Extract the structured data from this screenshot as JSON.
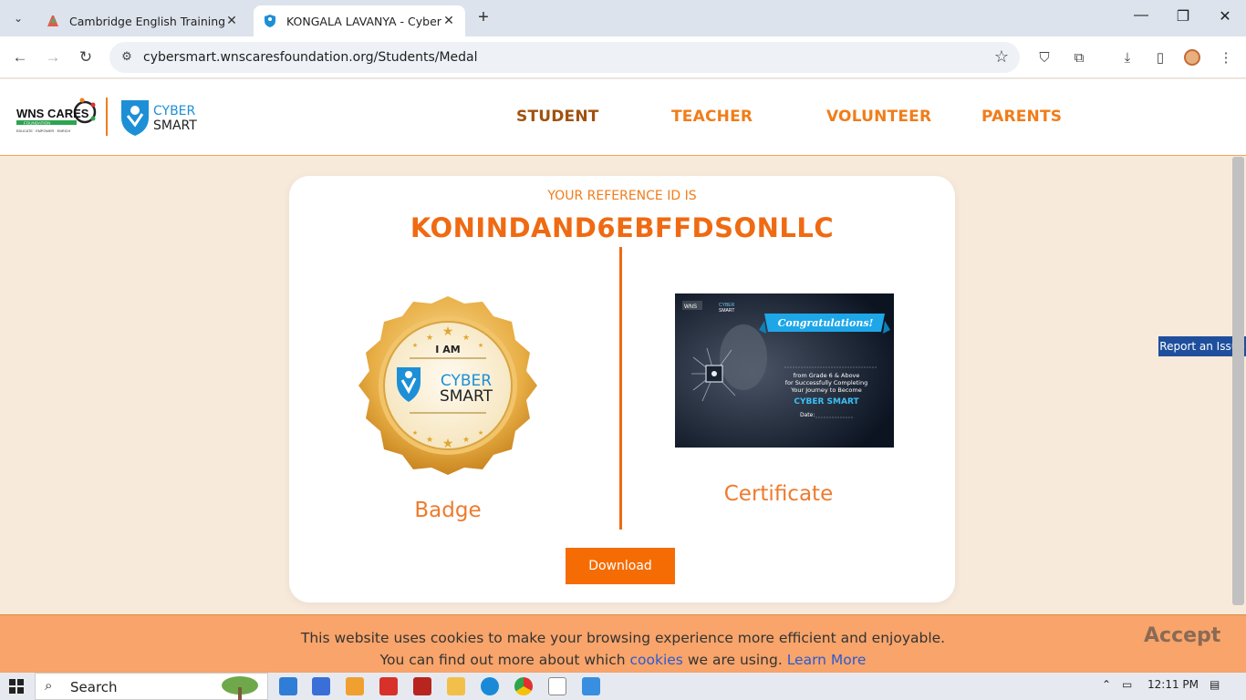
{
  "browser": {
    "tabs": [
      {
        "title": "Cambridge English Training | Ca",
        "active": false
      },
      {
        "title": "KONGALA LAVANYA - CyberSm",
        "active": true
      }
    ],
    "new_tab_icon": "plus-icon",
    "url": "cybersmart.wnscaresfoundation.org/Students/Medal"
  },
  "site": {
    "nav": [
      "STUDENT",
      "TEACHER",
      "VOLUNTEER",
      "PARENTS"
    ],
    "current_nav": "STUDENT",
    "logo_wns": "WNS CARES",
    "logo_foundation": "FOUNDATION",
    "logo_tagline": "EDUCATE · EMPOWER · ENRICH",
    "logo_cyber": "CYBER",
    "logo_smart": "SMART"
  },
  "main": {
    "ref_label": "YOUR REFERENCE ID IS",
    "ref_id": "KONINDAND6EBFFDSONLLC",
    "badge": {
      "label": "Badge",
      "iam": "I AM",
      "cyber": "CYBER",
      "smart": "SMART"
    },
    "certificate": {
      "label": "Certificate",
      "banner": "Congratulations!",
      "line1": "from Grade 6 & Above",
      "line2": "for Successfully Completing",
      "line3": "Your Journey to Become",
      "line4": "CYBER SMART",
      "date": "Date:"
    },
    "download_label": "Download"
  },
  "report_issue": "Report an Issue",
  "cookie": {
    "line1": "This website uses cookies to make your browsing experience more efficient and enjoyable.",
    "line2_prefix": "You can find out more about which ",
    "cookies_link": "cookies",
    "line2_mid": " we are using. ",
    "learn_more": "Learn More",
    "accept": "Accept"
  },
  "taskbar": {
    "search": "Search",
    "time": "12:11 PM"
  },
  "colors": {
    "brand_orange": "#ef6a12",
    "page_bg": "#f8eadb",
    "cookie_bg": "#f8a46a",
    "report_blue": "#1f4f9c"
  }
}
